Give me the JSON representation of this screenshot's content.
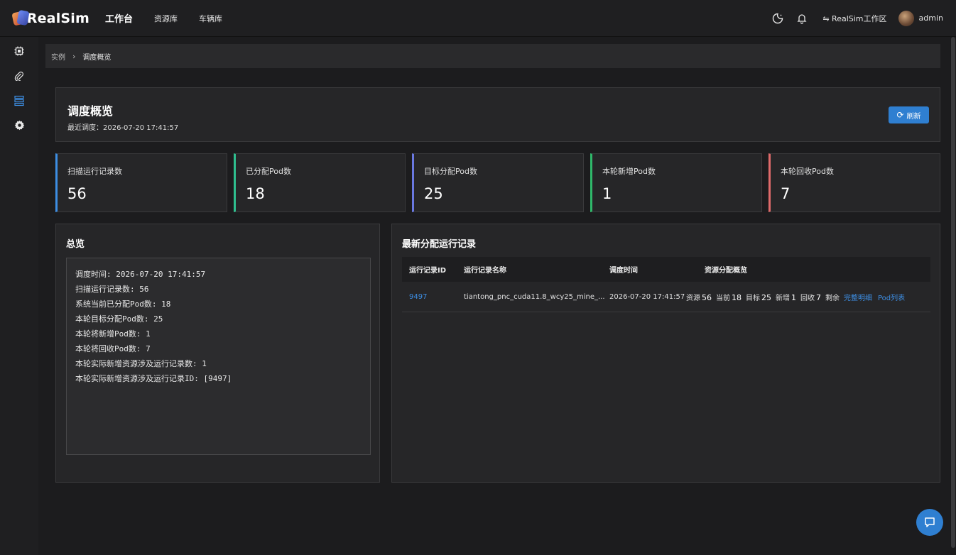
{
  "app": {
    "logo_text": "RealSim",
    "nav": [
      {
        "label": "工作台"
      },
      {
        "label": "资源库"
      },
      {
        "label": "车辆库"
      }
    ],
    "workspace": "⇋ RealSim工作区",
    "user": "admin"
  },
  "sidebar": {
    "items": [
      {
        "icon": "chip-icon"
      },
      {
        "icon": "paperclip-icon"
      },
      {
        "icon": "list-icon",
        "active": true
      },
      {
        "icon": "gear-icon"
      }
    ],
    "active_color": "#3d8ee3"
  },
  "breadcrumb": {
    "items": [
      "实例",
      "调度概览"
    ]
  },
  "header": {
    "title": "调度概览",
    "last_schedule": "最近调度：2026-07-20 17:41:57",
    "refresh_label": "刷新"
  },
  "stats": [
    {
      "label": "扫描运行记录数",
      "value": "56",
      "color": "#3d8ee3"
    },
    {
      "label": "已分配Pod数",
      "value": "18",
      "color": "#2fbf8f"
    },
    {
      "label": "目标分配Pod数",
      "value": "25",
      "color": "#6a78e0"
    },
    {
      "label": "本轮新增Pod数",
      "value": "1",
      "color": "#2fb86a"
    },
    {
      "label": "本轮回收Pod数",
      "value": "7",
      "color": "#e06a6a"
    }
  ],
  "overview": {
    "title": "总览",
    "lines": [
      "调度时间: 2026-07-20 17:41:57",
      "扫描运行记录数: 56",
      "系统当前已分配Pod数: 18",
      "本轮目标分配Pod数: 25",
      "本轮将新增Pod数: 1",
      "本轮将回收Pod数: 7",
      "本轮实际新增资源涉及运行记录数: 1",
      "本轮实际新增资源涉及运行记录ID: [9497]"
    ]
  },
  "records": {
    "title": "最新分配运行记录",
    "columns": [
      "运行记录ID",
      "运行记录名称",
      "调度时间",
      "资源分配概览"
    ],
    "rows": [
      {
        "id": "9497",
        "name": "tiantong_pnc_cuda11.8_wcy25_mine_...",
        "time": "2026-07-20 17:41:57",
        "res_label": "资源",
        "res": "56",
        "cur_label": "当前",
        "cur": "18",
        "target_label": "目标",
        "target": "25",
        "add_label": "新增",
        "add": "1",
        "recycle_label": "回收",
        "recycle": "7",
        "remain_label": "剩余",
        "detail_label": "完整明细",
        "pods_label": "Pod列表"
      }
    ]
  }
}
